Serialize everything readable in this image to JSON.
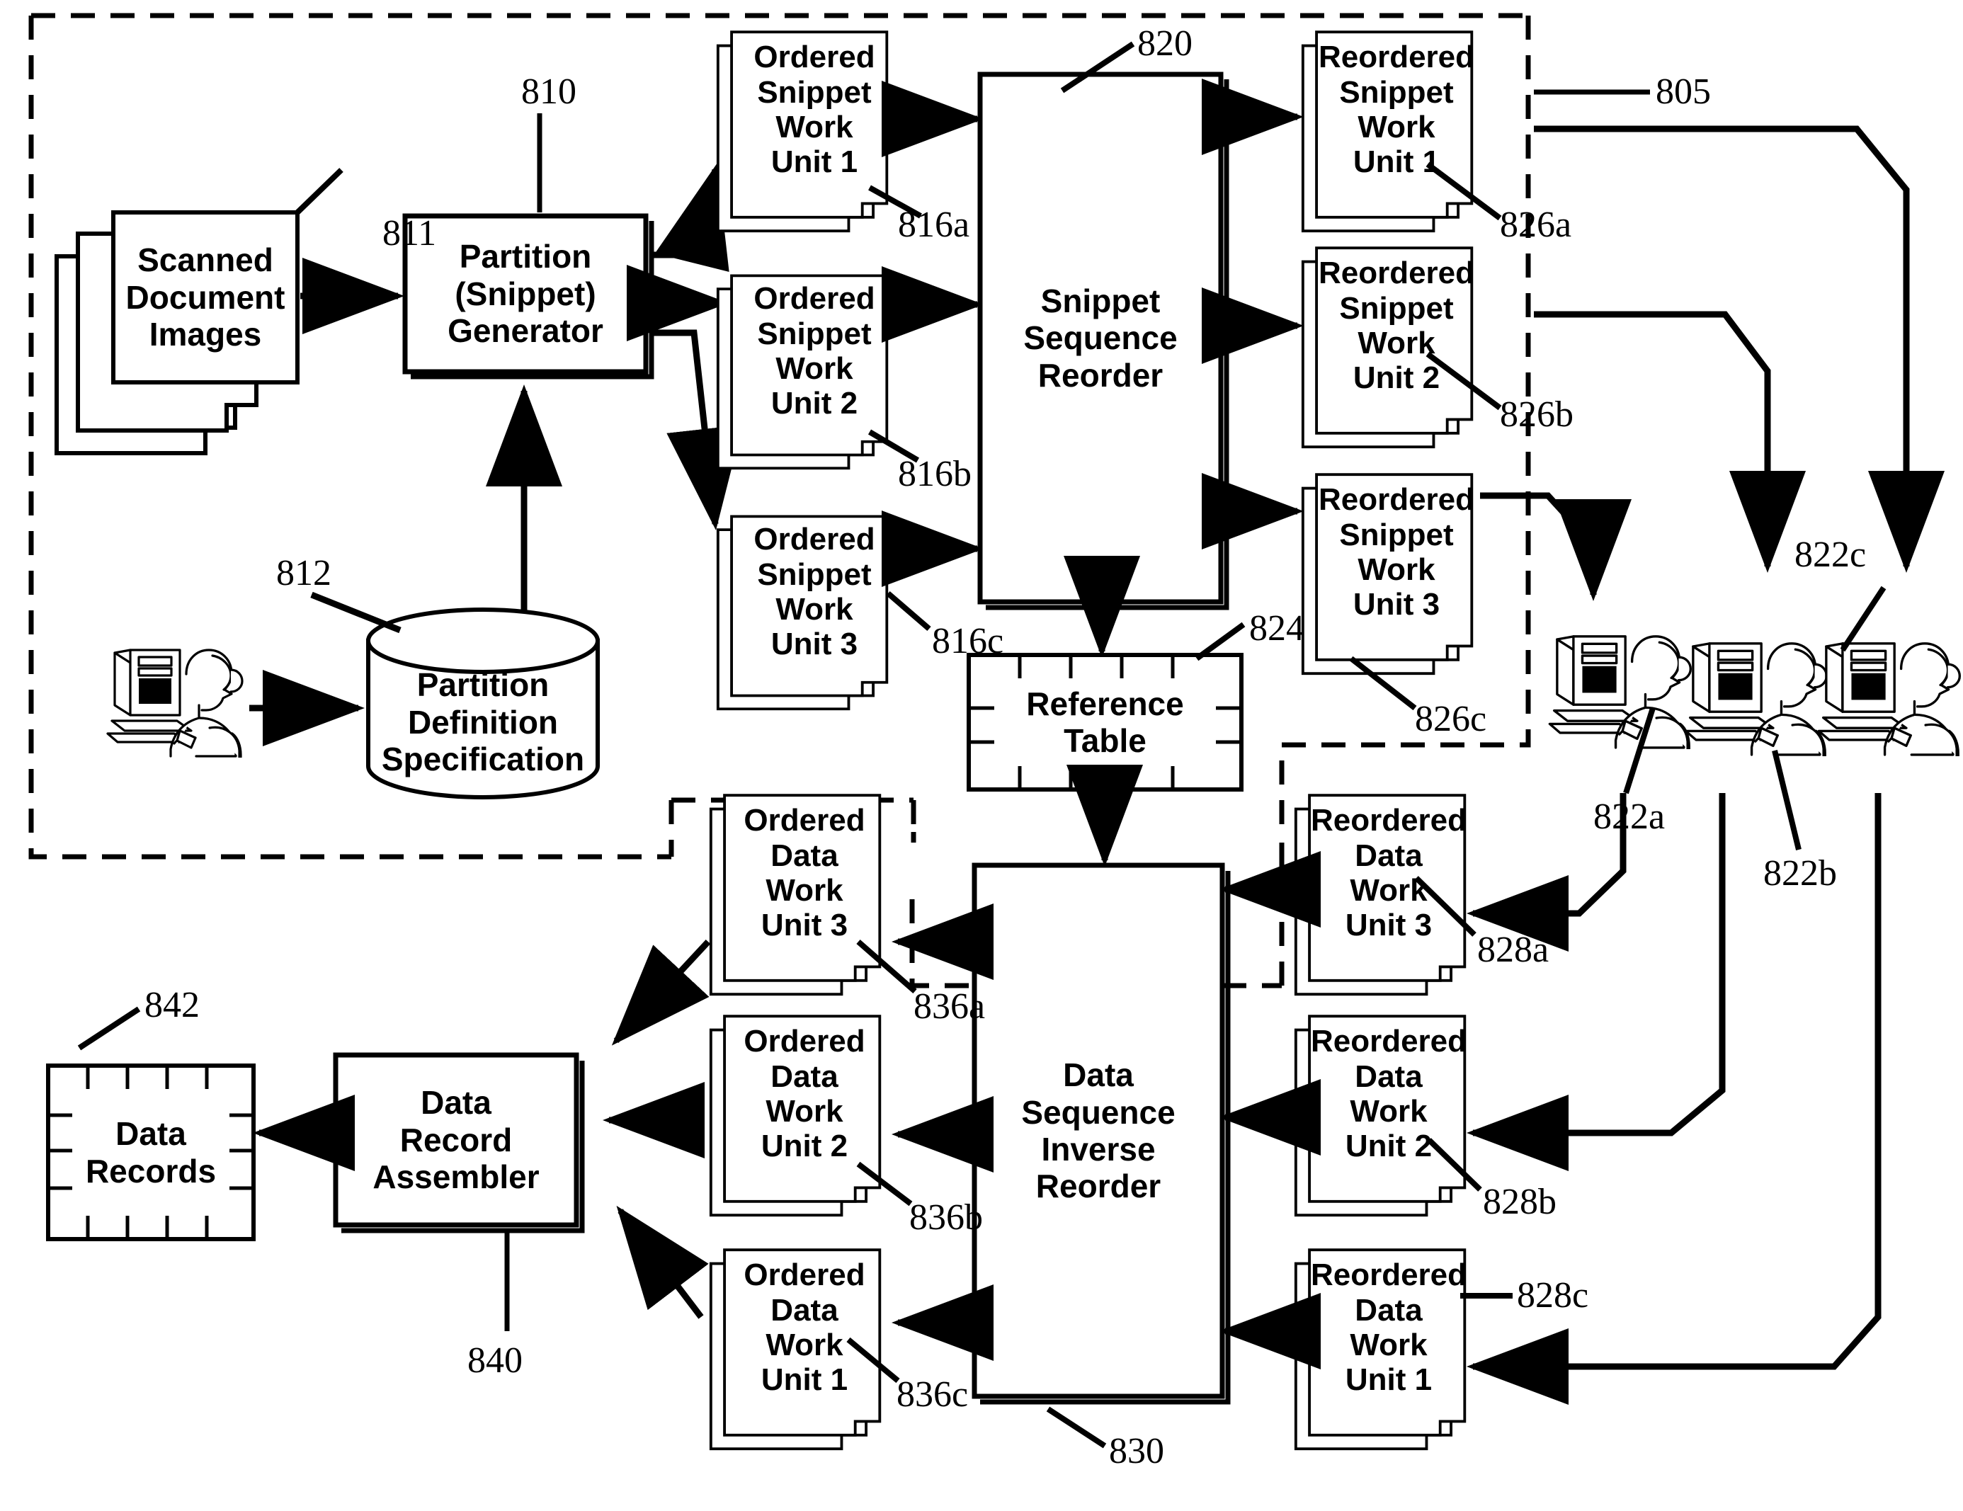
{
  "figure": {
    "title": "Document snippet partitioning and sequence reorder pipeline",
    "dashed_region_upper_label": "805"
  },
  "blocks": {
    "scanned_document_images": {
      "label": "Scanned\nDocument\nImages",
      "ref": "811"
    },
    "partition_generator": {
      "label": "Partition\n(Snippet)\nGenerator",
      "ref": "810"
    },
    "partition_definition_specification": {
      "label": "Partition\nDefinition\nSpecification",
      "ref": "812"
    },
    "snippet_sequence_reorder": {
      "label": "Snippet\nSequence\nReorder",
      "ref": "820"
    },
    "reference_table": {
      "label": "Reference\nTable",
      "ref": "824"
    },
    "data_sequence_inverse_reorder": {
      "label": "Data\nSequence\nInverse\nReorder",
      "ref": "830"
    },
    "data_record_assembler": {
      "label": "Data\nRecord\nAssembler",
      "ref": "840"
    },
    "data_records": {
      "label": "Data\nRecords",
      "ref": "842"
    }
  },
  "ordered_snippet_work_units": [
    {
      "label": "Ordered\nSnippet\nWork\nUnit 1",
      "ref": "816a"
    },
    {
      "label": "Ordered\nSnippet\nWork\nUnit 2",
      "ref": "816b"
    },
    {
      "label": "Ordered\nSnippet\nWork\nUnit 3",
      "ref": "816c"
    }
  ],
  "reordered_snippet_work_units": [
    {
      "label": "Reordered\nSnippet\nWork\nUnit 1",
      "ref": "826a"
    },
    {
      "label": "Reordered\nSnippet\nWork\nUnit 2",
      "ref": "826b"
    },
    {
      "label": "Reordered\nSnippet\nWork\nUnit 3",
      "ref": "826c"
    }
  ],
  "ordered_data_work_units": [
    {
      "label": "Ordered\nData\nWork\nUnit 3",
      "ref": "836a"
    },
    {
      "label": "Ordered\nData\nWork\nUnit 2",
      "ref": "836b"
    },
    {
      "label": "Ordered\nData\nWork\nUnit 1",
      "ref": "836c"
    }
  ],
  "reordered_data_work_units": [
    {
      "label": "Reordered\nData\nWork\nUnit 3",
      "ref": "828a"
    },
    {
      "label": "Reordered\nData\nWork\nUnit 2",
      "ref": "828b"
    },
    {
      "label": "Reordered\nData\nWork\nUnit 1",
      "ref": "828c"
    }
  ],
  "operator_workstations": [
    {
      "ref": "822a"
    },
    {
      "ref": "822b"
    },
    {
      "ref": "822c"
    }
  ],
  "admin_workstation": {
    "ref": ""
  },
  "colors": {
    "ink": "#000000",
    "paper": "#ffffff"
  }
}
